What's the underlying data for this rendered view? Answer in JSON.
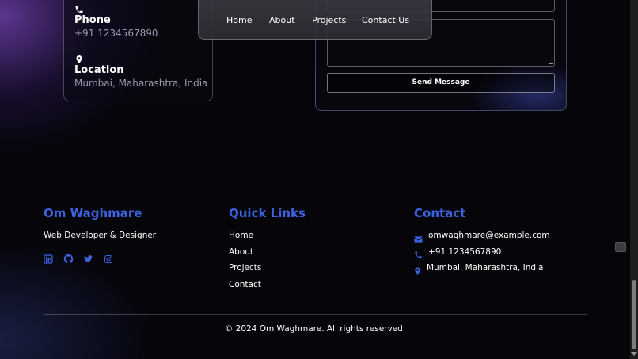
{
  "contact_info": {
    "phone_title": "Phone",
    "phone_value": "+91 1234567890",
    "location_title": "Location",
    "location_value": "Mumbai, Maharashtra, India"
  },
  "form": {
    "send_label": "Send Message"
  },
  "nav": {
    "items": [
      "Home",
      "About",
      "Projects",
      "Contact Us"
    ]
  },
  "footer": {
    "brand": "Om Waghmare",
    "tagline": "Web Developer & Designer",
    "social_icons": [
      "linkedin-icon",
      "github-icon",
      "twitter-icon",
      "instagram-icon"
    ],
    "quick_links_heading": "Quick Links",
    "quick_links": [
      "Home",
      "About",
      "Projects",
      "Contact"
    ],
    "contact_heading": "Contact",
    "email": "omwaghmare@example.com",
    "phone": "+91 1234567890",
    "location": "Mumbai, Maharashtra, India",
    "copyright": "© 2024 Om Waghmare. All rights reserved."
  },
  "colors": {
    "accent": "#3d63e0",
    "background": "#05050a"
  }
}
